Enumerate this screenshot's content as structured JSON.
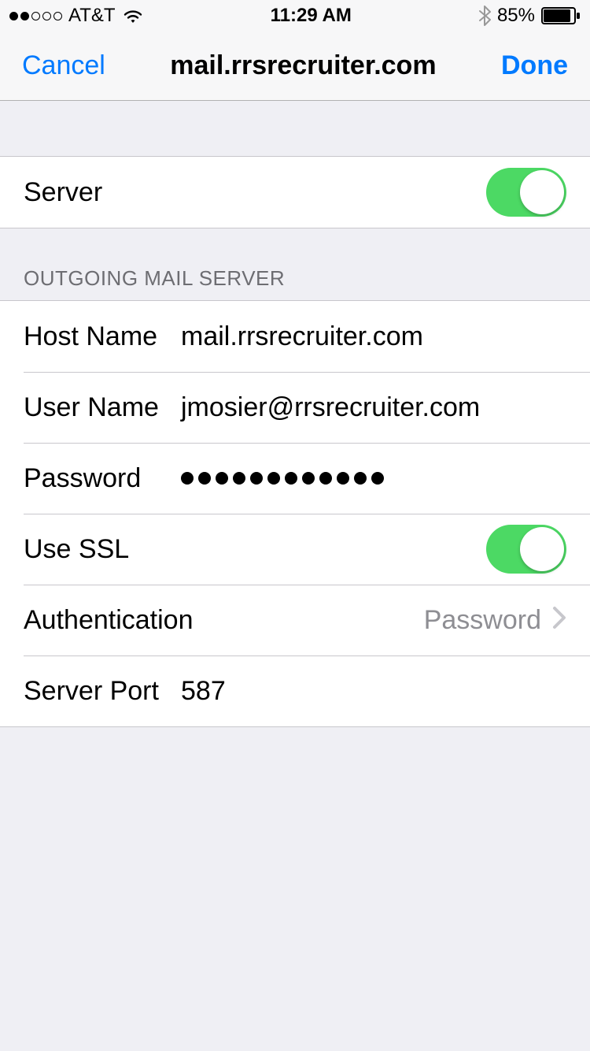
{
  "statusBar": {
    "carrier": "AT&T",
    "time": "11:29 AM",
    "batteryPct": "85%"
  },
  "nav": {
    "cancel": "Cancel",
    "title": "mail.rrsrecruiter.com",
    "done": "Done"
  },
  "serverToggle": {
    "label": "Server",
    "on": true
  },
  "outgoing": {
    "header": "OUTGOING MAIL SERVER",
    "hostNameLabel": "Host Name",
    "hostName": "mail.rrsrecruiter.com",
    "userNameLabel": "User Name",
    "userName": "jmosier@rrsrecruiter.com",
    "passwordLabel": "Password",
    "passwordMasked": "••••••••••••",
    "useSslLabel": "Use SSL",
    "useSslOn": true,
    "authLabel": "Authentication",
    "authValue": "Password",
    "serverPortLabel": "Server Port",
    "serverPort": "587"
  }
}
